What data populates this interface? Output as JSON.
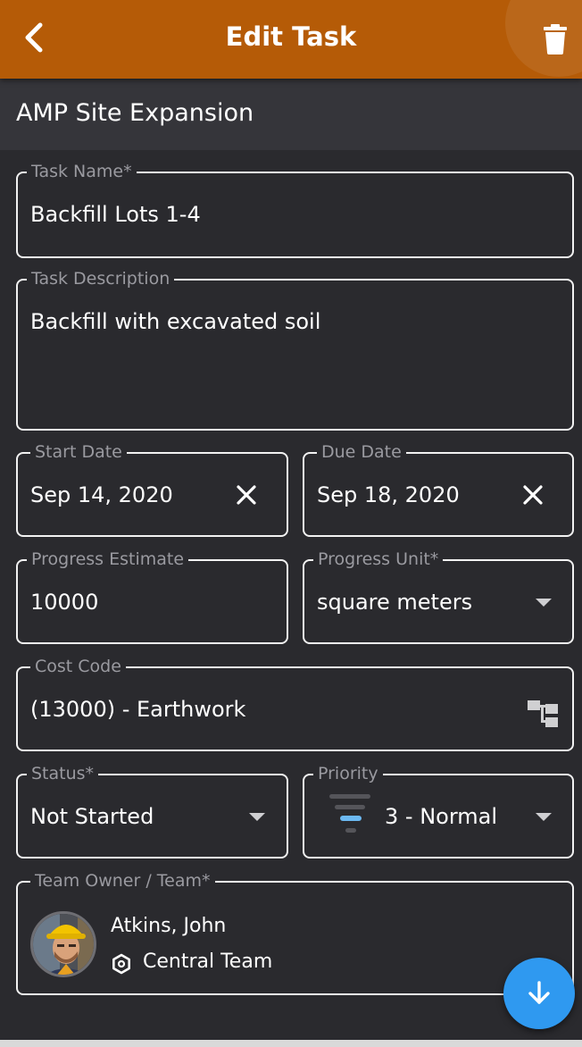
{
  "header": {
    "title": "Edit Task",
    "back_icon": "chevron-left-icon",
    "delete_icon": "trash-icon",
    "color": "#b55b07"
  },
  "project": {
    "name": "AMP Site Expansion"
  },
  "form": {
    "task_name": {
      "label": "Task Name*",
      "value": "Backfill Lots 1-4"
    },
    "task_description": {
      "label": "Task Description",
      "value": "Backfill with excavated soil"
    },
    "start_date": {
      "label": "Start Date",
      "value": "Sep 14, 2020",
      "clear_icon": "close-icon"
    },
    "due_date": {
      "label": "Due Date",
      "value": "Sep 18, 2020",
      "clear_icon": "close-icon"
    },
    "progress_estimate": {
      "label": "Progress Estimate",
      "value": "10000"
    },
    "progress_unit": {
      "label": "Progress Unit*",
      "value": "square meters"
    },
    "cost_code": {
      "label": "Cost Code",
      "value": "(13000) - Earthwork",
      "icon": "hierarchy-icon"
    },
    "status": {
      "label": "Status*",
      "value": "Not Started"
    },
    "priority": {
      "label": "Priority",
      "value": "3 - Normal",
      "icon": "priority-level-icon"
    },
    "team_owner": {
      "label": "Team Owner / Team*",
      "owner": "Atkins, John",
      "team": "Central Team",
      "team_icon": "gear-icon"
    }
  },
  "fab": {
    "icon": "arrow-down-icon",
    "color": "#2f99f0"
  }
}
